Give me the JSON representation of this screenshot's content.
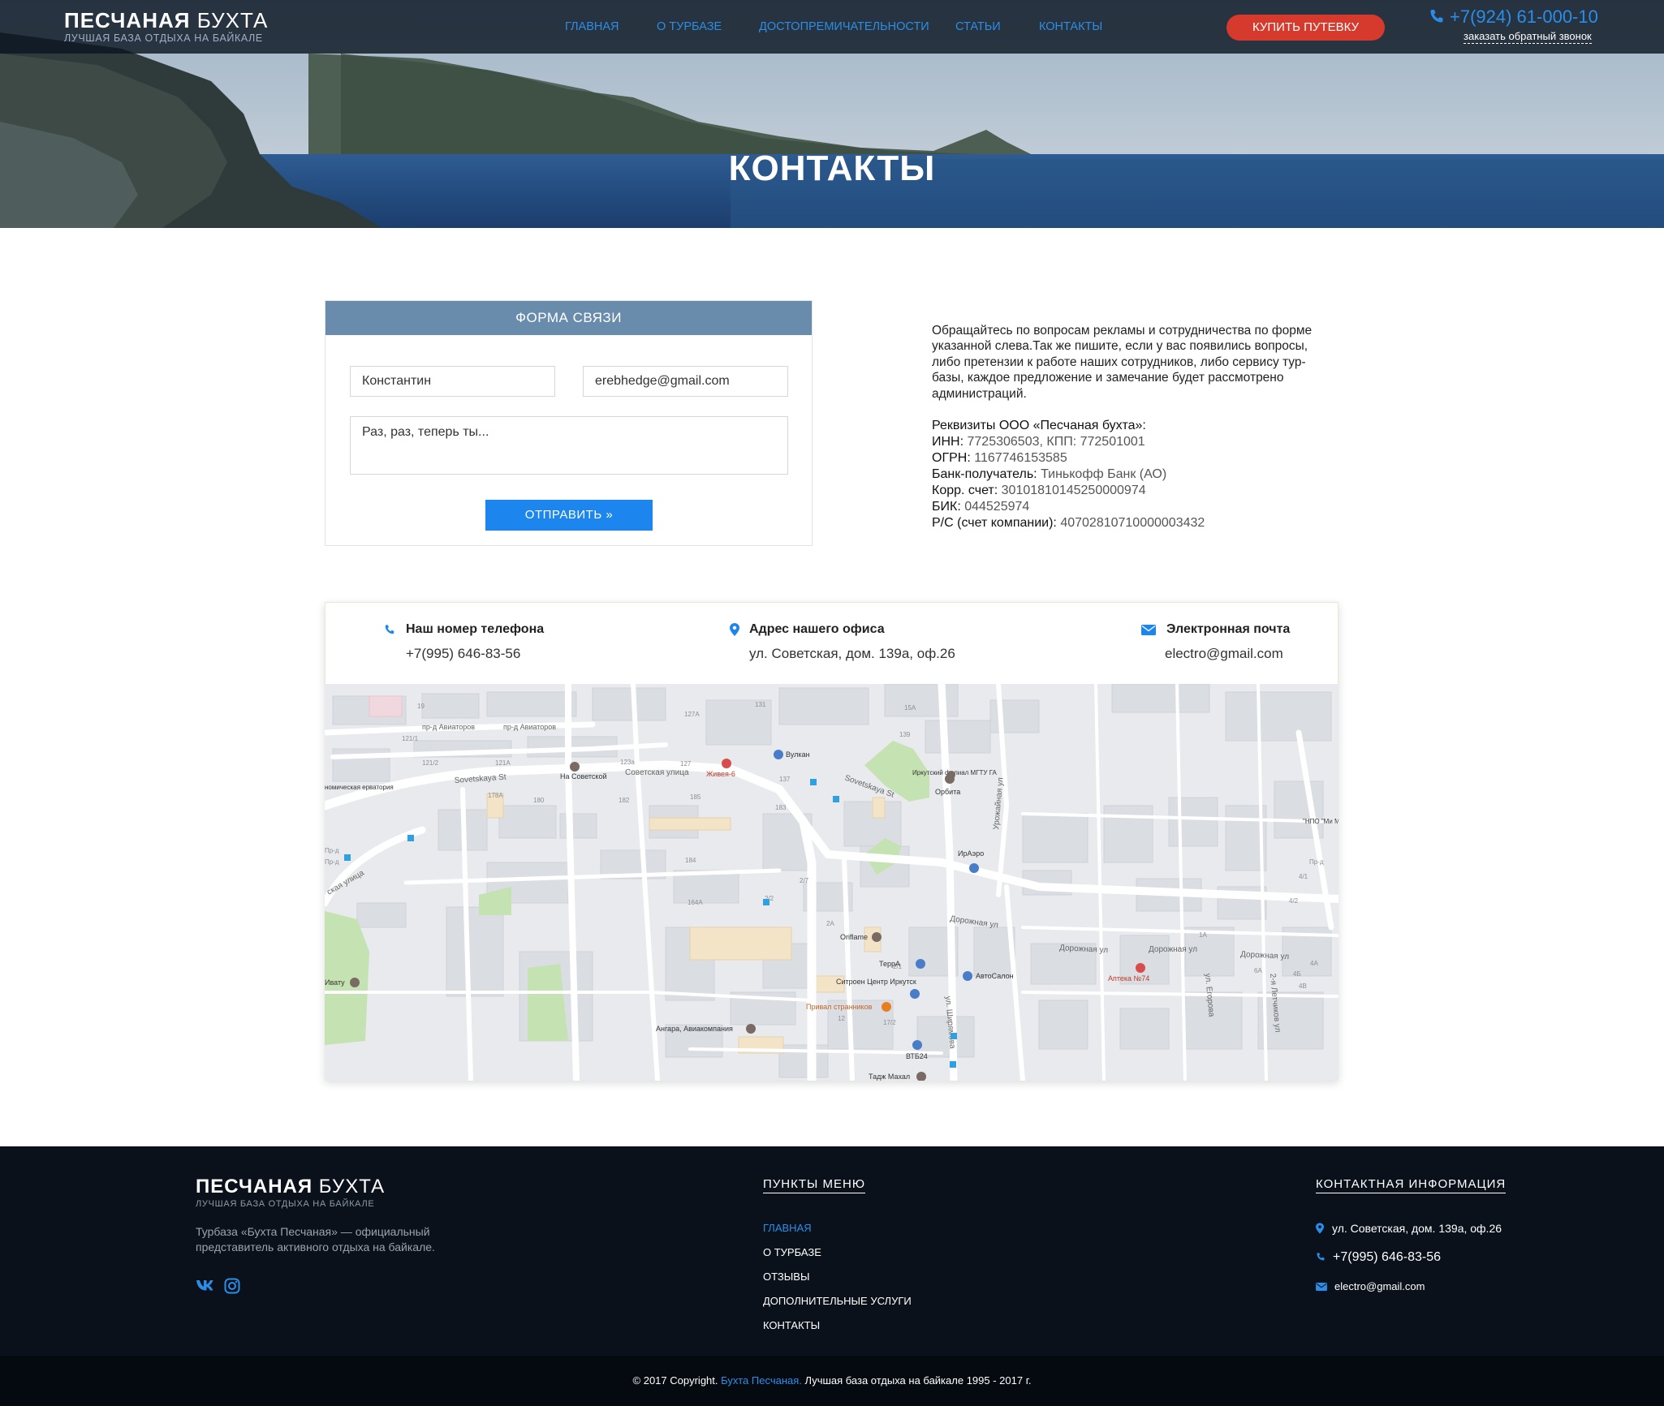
{
  "header": {
    "logo_bold": "ПЕСЧАНАЯ",
    "logo_light": "БУХТА",
    "tagline": "ЛУЧШАЯ БАЗА ОТДЫХА НА БАЙКАЛЕ",
    "nav": [
      "ГЛАВНАЯ",
      "О ТУРБАЗЕ",
      "ДОСТОПРЕМИЧАТЕЛЬНОСТИ",
      "СТАТЬИ",
      "КОНТАКТЫ"
    ],
    "buy_button": "КУПИТЬ ПУТЕВКУ",
    "phone": "+7(924) 61-000-10",
    "callback": "заказать обратный звонок",
    "accent": "#2a8ee8",
    "button_color": "#d53a2c"
  },
  "hero": {
    "title": "КОНТАКТЫ"
  },
  "form": {
    "title": "ФОРМА СВЯЗИ",
    "name_value": "Константин",
    "email_value": "erebhedge@gmail.com",
    "message_placeholder": "Раз, раз, теперь ты...",
    "submit": "ОТПРАВИТЬ »"
  },
  "info": {
    "text": "Обращайтесь по вопросам рекламы  и сотрудничества по форме указанной слева.Так же пишите, если у вас появились вопросы, либо претензии к работе наших сотрудников, либо сервису тур-базы, каждое предложение и замечание будет рассмотрено администраций.",
    "requisites_title": "Реквизиты ООО «Песчаная бухта»:",
    "requisites": [
      {
        "key": "ИНН:",
        "value": " 7725306503, КПП: 772501001"
      },
      {
        "key": "ОГРН:",
        "value": " 1167746153585"
      },
      {
        "key": "Банк-получатель:",
        "value": " Тинькофф Банк (АО)"
      },
      {
        "key": "Корр. счет:",
        "value": " 30101810145250000974"
      },
      {
        "key": "БИК:",
        "value": " 044525974"
      },
      {
        "key": "Р/С (счет компании):",
        "value": " 40702810710000003432"
      }
    ]
  },
  "contacts": {
    "phone_title": "Наш номер телефона",
    "phone_value": "+7(995) 646-83-56",
    "address_title": "Адрес нашего офиса",
    "address_value": "ул. Советская, дом. 139а, оф.26",
    "email_title": "Электронная почта",
    "email_value": "electro@gmail.com"
  },
  "map": {
    "streets": [
      "Советская улица",
      "Sovetskaya St",
      "Sovetskaya St",
      "Дорожная ул",
      "Дорожная ул",
      "Дорожная ул",
      "Дорожная ул",
      "Урожайная ул",
      "ул. Ширямова",
      "пр-д Авиаторов",
      "пр-д Авиаторов",
      "ская улица",
      "ул. Егорова",
      "2-я Летчиков ул"
    ],
    "pois": [
      "На Советской",
      "Живея-6",
      "Вулкан",
      "Иркутский филиал МГТУ ГА",
      "Орбита",
      "ИрАэро",
      "Oriflame",
      "ТеррА",
      "Ситроен Центр Иркутск",
      "Привал странников",
      "Ангара, Авиакомпания",
      "ВТБ24",
      "Тадж Махал",
      "АвтоСалон",
      "Аптека №74",
      "Ивату",
      "номическая ерватория",
      "\"НПО \"Ми МЗ РФ Ир"
    ],
    "numbers": [
      "19",
      "121/2",
      "121/1",
      "121А",
      "123а",
      "127",
      "127А",
      "131",
      "137",
      "139",
      "15А",
      "180",
      "178А",
      "182",
      "183",
      "185",
      "184",
      "164А",
      "2/7",
      "2/2",
      "2А",
      "2/1",
      "12",
      "17/2",
      "1А",
      "4А",
      "4Б",
      "4В",
      "4/2",
      "4/1",
      "6А",
      "Пр-д",
      "Пр-д",
      "Пр-д"
    ]
  },
  "footer": {
    "logo_bold": "ПЕСЧАНАЯ",
    "logo_light": "БУХТА",
    "tagline": "ЛУЧШАЯ БАЗА ОТДЫХА НА БАЙКАЛЕ",
    "description": "Турбаза «Бухта Песчаная» — официальный представитель активного отдыха на байкале.",
    "menu_title": "ПУНКТЫ МЕНЮ",
    "menu": [
      "ГЛАВНАЯ",
      "О ТУРБАЗЕ",
      "ОТЗЫВЫ",
      "ДОПОЛНИТЕЛЬНЫЕ УСЛУГИ",
      "КОНТАКТЫ"
    ],
    "contact_title": "КОНТАКТНАЯ ИНФОРМАЦИЯ",
    "address": "ул. Советская, дом. 139а, оф.26",
    "phone": "+7(995) 646-83-56",
    "email": "electro@gmail.com",
    "copyright_pre": "© 2017 Copyright.",
    "copyright_link": "Бухта Песчаная.",
    "copyright_post": "Лучшая база отдыха на байкале 1995 - 2017 г."
  }
}
